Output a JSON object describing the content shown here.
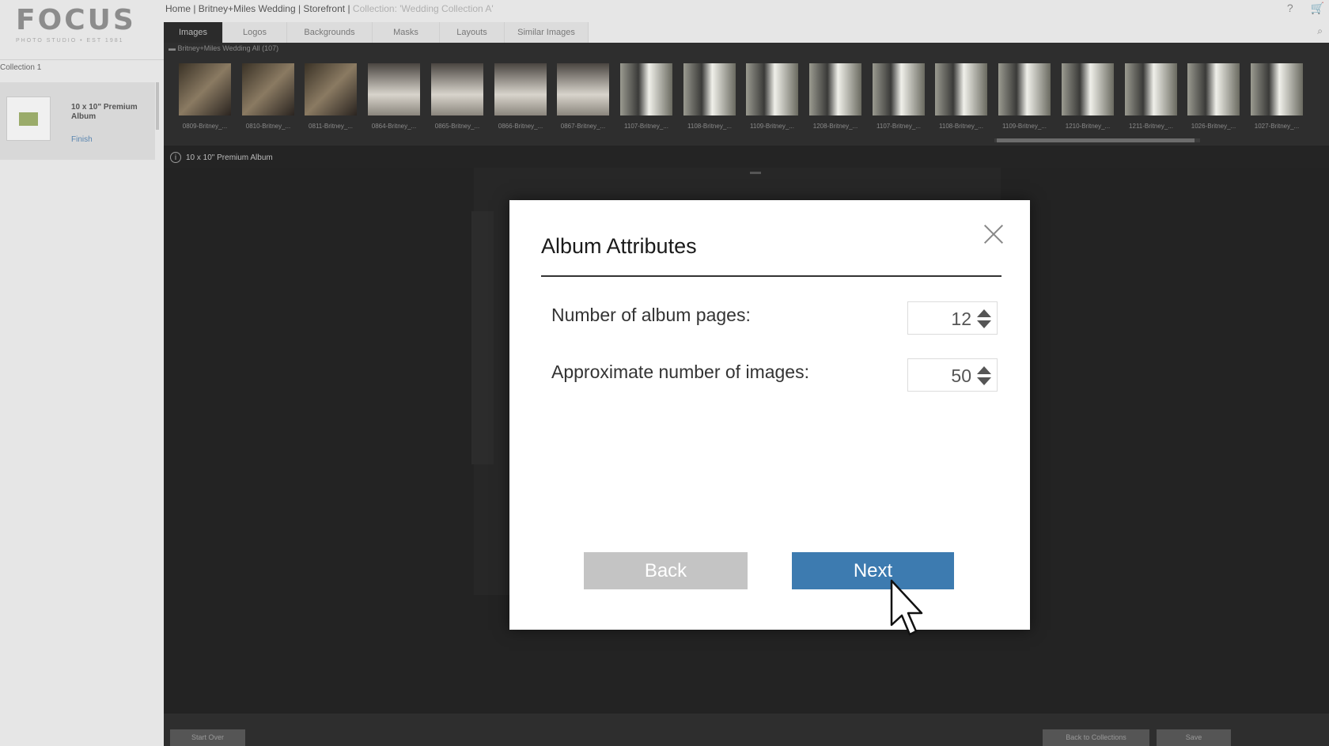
{
  "brand": {
    "logo": "FOCUS",
    "tagline": "PHOTO STUDIO • EST 1981"
  },
  "sidebar": {
    "collection_label": "Collection 1",
    "product": {
      "name": "10 x 10\" Premium Album",
      "finish_link": "Finish"
    }
  },
  "breadcrumb": {
    "trail": "Home | Britney+Miles Wedding | Storefront |",
    "current": "Collection: 'Wedding Collection A'"
  },
  "top_icons": {
    "help": "?",
    "cart": "🛒"
  },
  "tabs": [
    {
      "label": "Images",
      "active": true
    },
    {
      "label": "Logos"
    },
    {
      "label": "Backgrounds"
    },
    {
      "label": "Masks"
    },
    {
      "label": "Layouts"
    },
    {
      "label": "Similar Images"
    }
  ],
  "filmstrip": {
    "folder_label": "Britney+Miles Wedding All (107)",
    "thumbnails": [
      {
        "label": "0809-Britney_..."
      },
      {
        "label": "0810-Britney_..."
      },
      {
        "label": "0811-Britney_..."
      },
      {
        "label": "0864-Britney_..."
      },
      {
        "label": "0865-Britney_..."
      },
      {
        "label": "0866-Britney_..."
      },
      {
        "label": "0867-Britney_..."
      },
      {
        "label": "1107-Britney_..."
      },
      {
        "label": "1108-Britney_..."
      },
      {
        "label": "1109-Britney_..."
      },
      {
        "label": "1208-Britney_..."
      },
      {
        "label": "1107-Britney_..."
      },
      {
        "label": "1108-Britney_..."
      },
      {
        "label": "1109-Britney_..."
      },
      {
        "label": "1210-Britney_..."
      },
      {
        "label": "1211-Britney_..."
      },
      {
        "label": "1026-Britney_..."
      },
      {
        "label": "1027-Britney_..."
      }
    ]
  },
  "infobar": {
    "product_name": "10 x 10\" Premium Album"
  },
  "bottom": {
    "start_over": "Start Over",
    "back_to_collections": "Back to Collections",
    "save": "Save"
  },
  "modal": {
    "title": "Album Attributes",
    "fields": [
      {
        "label": "Number of album pages:",
        "value": "12"
      },
      {
        "label": "Approximate number of images:",
        "value": "50"
      }
    ],
    "back_label": "Back",
    "next_label": "Next"
  },
  "colors": {
    "next_button": "#3d7bb0",
    "back_button": "#c4c4c4",
    "workspace": "#232323"
  }
}
